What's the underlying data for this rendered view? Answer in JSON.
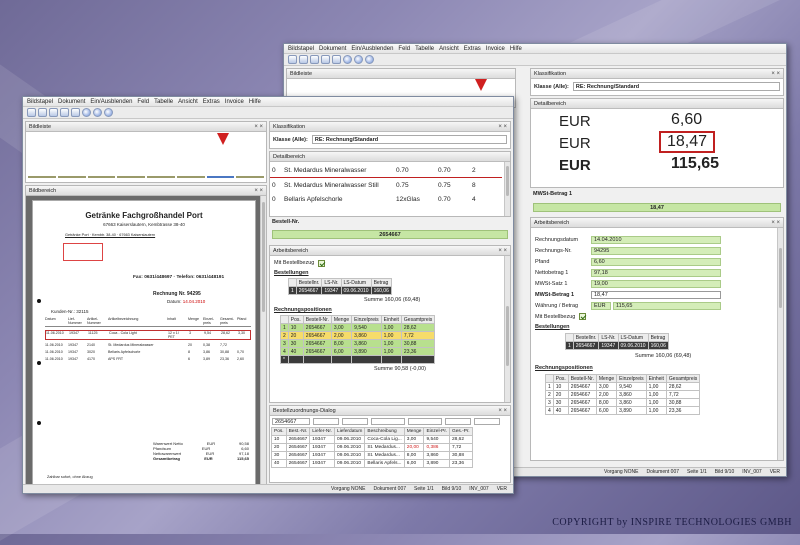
{
  "menu": [
    "Bildstapel",
    "Dokument",
    "Ein/Ausblenden",
    "Feld",
    "Tabelle",
    "Ansicht",
    "Extras",
    "Invoice",
    "Hilfe"
  ],
  "panels": {
    "bildleiste": "Bildleiste",
    "bildbereich": "Bildbereich",
    "klassifikation": "Klassifikation",
    "detailbereich": "Detailbereich",
    "arbeitsbereich": "Arbeitsbereich",
    "bestelldialog": "Bestellzuordnungs-Dialog"
  },
  "klasse": {
    "label": "Klasse (Alle):",
    "value": "RE: Rechnung/Standard"
  },
  "back": {
    "detail": {
      "currency": "EUR",
      "v1": "6,60",
      "v2": "18,47",
      "v3": "115,65"
    },
    "mwst_label": "MWSt-Betrag 1",
    "mwst_value": "18,47",
    "fields": [
      {
        "label": "Rechnungsdatum",
        "value": "14.04.2010"
      },
      {
        "label": "Rechnungs-Nr.",
        "value": "94295"
      },
      {
        "label": "Pfand",
        "value": "6,60"
      },
      {
        "label": "Nettobetrag 1",
        "value": "97,18"
      },
      {
        "label": "MWSt-Satz 1",
        "value": "19,00"
      },
      {
        "label": "MWSt-Betrag 1",
        "value": "18,47"
      }
    ],
    "waehrung": {
      "label": "Währung / Betrag",
      "cur": "EUR",
      "value": "115,65"
    },
    "mitbestell": "Mit Bestellbezug",
    "bestellungen_title": "Bestellungen",
    "bestell_headers": [
      "Bestellnr.",
      "LS-Nr.",
      "LS-Datum",
      "Betrag"
    ],
    "bestell_row": [
      "2654667",
      "19347",
      "09.06.2010",
      "160,06"
    ],
    "summe": "Summe 160,06 (69,48)",
    "rp_title": "Rechnungspositionen",
    "rp_headers": [
      "Pos.",
      "Bestell-Nr.",
      "Menge",
      "Einzelpreis",
      "Einheit",
      "Gesamtpreis"
    ],
    "rp_rows": [
      [
        "10",
        "2654667",
        "3,00",
        "9,540",
        "1,00",
        "28,62"
      ],
      [
        "20",
        "2654667",
        "2,00",
        "3,860",
        "1,00",
        "7,72"
      ],
      [
        "30",
        "2654667",
        "8,00",
        "3,860",
        "1,00",
        "30,88"
      ],
      [
        "40",
        "2654667",
        "6,00",
        "3,890",
        "1,00",
        "23,36"
      ]
    ],
    "status": [
      "Vorgang NONE",
      "Dokument 007",
      "Seite 1/1",
      "Bild 9/10",
      "INV_007",
      "VER"
    ]
  },
  "front": {
    "detail_rows": [
      {
        "n": "0",
        "name": "St. Medardus Mineralwasser",
        "a": "0.70",
        "b": "0.70",
        "c": "2"
      },
      {
        "n": "0",
        "name": "St. Medardus Mineralwasser Still",
        "a": "0.75",
        "b": "0.75",
        "c": "8"
      },
      {
        "n": "0",
        "name": "Bellaris Apfelschorle",
        "a": "12xGlas",
        "b": "0.70",
        "c": "4"
      }
    ],
    "bestellnr_label": "Bestell-Nr.",
    "bestellnr_value": "2654667",
    "mitbestell": "Mit Bestellbezug",
    "bestellungen_title": "Bestellungen",
    "bestell_headers": [
      "Bestellnr.",
      "LS-Nr.",
      "LS-Datum",
      "Betrag"
    ],
    "bestell_row": [
      "2654667",
      "19347",
      "09.06.2010",
      "160,06"
    ],
    "summe": "Summe 160,06 (69,48)",
    "rp_title": "Rechnungspositionen",
    "rp_headers": [
      "Pos.",
      "Bestell-Nr.",
      "Menge",
      "Einzelpreis",
      "Einheit",
      "Gesamtpreis"
    ],
    "rp_rows": [
      [
        "10",
        "2654667",
        "3,00",
        "9,540",
        "1,00",
        "28,62"
      ],
      [
        "20",
        "2654667",
        "2,00",
        "3,860",
        "1,00",
        "7,72"
      ],
      [
        "30",
        "2654667",
        "8,00",
        "3,860",
        "1,00",
        "30,88"
      ],
      [
        "40",
        "2654667",
        "6,00",
        "3,890",
        "1,00",
        "23,36"
      ]
    ],
    "rp_summe": "Summe 90,58 (-0,00)",
    "dialog_select": "2654667",
    "dialog_headers": [
      "Pos.",
      "Best.-Nr.",
      "Liefer-Nr.",
      "Lieferdatum",
      "Beschreibung",
      "Menge",
      "Einzel-Pr.",
      "Ges.-Pr."
    ],
    "dialog_rows": [
      [
        "10",
        "2654667",
        "19347",
        "09.06.2010",
        "Coca-Cola Lig...",
        "3,00",
        "9,540",
        "28,62"
      ],
      [
        "20",
        "2654667",
        "19347",
        "09.06.2010",
        "St. Medardus...",
        "20,00",
        "0,386",
        "7,72"
      ],
      [
        "30",
        "2654667",
        "19347",
        "09.06.2010",
        "St. Medardus...",
        "8,00",
        "3,860",
        "30,88"
      ],
      [
        "40",
        "2654667",
        "19347",
        "09.06.2010",
        "Bellaris Apfels...",
        "6,00",
        "3,890",
        "23,36"
      ]
    ],
    "status": [
      "Vorgang NONE",
      "Dokument 007",
      "Seite 1/1",
      "Bild 9/10",
      "INV_007",
      "VER"
    ]
  },
  "invoice": {
    "company": "Getränke Fachgroßhandel Port",
    "address": "67663 Kaiserslautern, Kembtrasse 38-40",
    "sender": "Getränke Port · Kembtr. 38-40 · 67663 Kaiserslautern",
    "phone": "Fax: 0631/448697 · Telefon: 0631/448191",
    "rechnung_label": "Rechnung Nr.",
    "rechnung_nr": "94295",
    "datum_label": "Datum:",
    "datum": "14.04.2010",
    "kunde": "Kunden-Nr.: 32115",
    "table_headers": [
      "Datum",
      "Lief-Nummer",
      "Artikel-Nummer",
      "Artikelbezeichnung",
      "Inhalt",
      "Menge",
      "Einzel-preis",
      "Gesamt-preis",
      "Pfand"
    ],
    "lines": [
      [
        "11.06.2010",
        "19347",
        "11125",
        "Coca - Cola Light",
        "12 x 1l PET",
        "3",
        "9,54",
        "28,62",
        "3,30"
      ],
      [
        "11.06.2010",
        "19347",
        "2140",
        "St. Medardus Mineralwasser",
        "",
        "20",
        "0,38",
        "7,72",
        ""
      ],
      [
        "11.06.2010",
        "19347",
        "3020",
        "Bellaris Apfelschorle",
        "",
        "8",
        "3,86",
        "30,88",
        "0,70"
      ],
      [
        "11.06.2010",
        "19347",
        "4170",
        "APS FRT",
        "",
        "6",
        "3,89",
        "23,36",
        "2,60"
      ]
    ],
    "totals": [
      {
        "label": "Warenwert Netto",
        "cur": "EUR",
        "value": "90,58"
      },
      {
        "label": "Pfandsum",
        "cur": "EUR",
        "value": "6,60"
      },
      {
        "label": "Nettowarenwert",
        "cur": "EUR",
        "value": "97,18"
      },
      {
        "label": "Gesamtbetrag",
        "cur": "EUR",
        "value": "115,65"
      }
    ],
    "footer": "Zahlbar sofort, ohne Abzug"
  },
  "copyright": "COPYRIGHT by INSPIRE TECHNOLOGIES GMBH"
}
